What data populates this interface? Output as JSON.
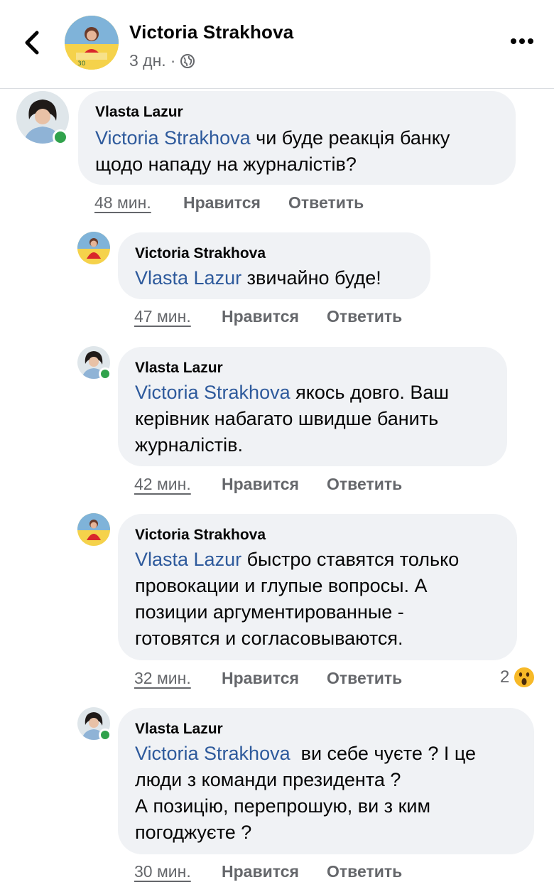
{
  "header": {
    "name": "Victoria Strakhova",
    "time": "3 дн.",
    "separator": "·"
  },
  "comments": [
    {
      "author": "Vlasta Lazur",
      "mention": "Victoria Strakhova",
      "text": " чи буде реакція банку\nщодо нападу на журналістів?",
      "time": "48 мин.",
      "like": "Нравится",
      "reply": "Ответить"
    },
    {
      "author": "Victoria Strakhova",
      "mention": "Vlasta Lazur",
      "text": " звичайно буде!",
      "time": "47 мин.",
      "like": "Нравится",
      "reply": "Ответить"
    },
    {
      "author": "Vlasta Lazur",
      "mention": "Victoria Strakhova",
      "text": " якось довго. Ваш\nкерівник набагато швидше банить\nжурналістів.",
      "time": "42 мин.",
      "like": "Нравится",
      "reply": "Ответить"
    },
    {
      "author": "Victoria Strakhova",
      "mention": "Vlasta Lazur",
      "text": " быстро ставятся только\nпровокации и глупые вопросы. А\nпозиции аргументированные -\nготовятся и согласовываются.",
      "time": "32 мин.",
      "like": "Нравится",
      "reply": "Ответить",
      "reaction_count": "2",
      "reaction_icon": "wow-emoji-icon"
    },
    {
      "author": "Vlasta Lazur",
      "mention": "Victoria Strakhova",
      "text": "  ви себе чуєте ? І це\nлюди з команди президента ?\nА позицію, перепрошую, ви з ким\nпогоджуєте ?",
      "time": "30 мин.",
      "like": "Нравится",
      "reply": "Ответить"
    }
  ],
  "colors": {
    "mention": "#2e5a9c",
    "bubble": "#f0f2f5",
    "meta": "#65676b",
    "online": "#31a24c"
  }
}
